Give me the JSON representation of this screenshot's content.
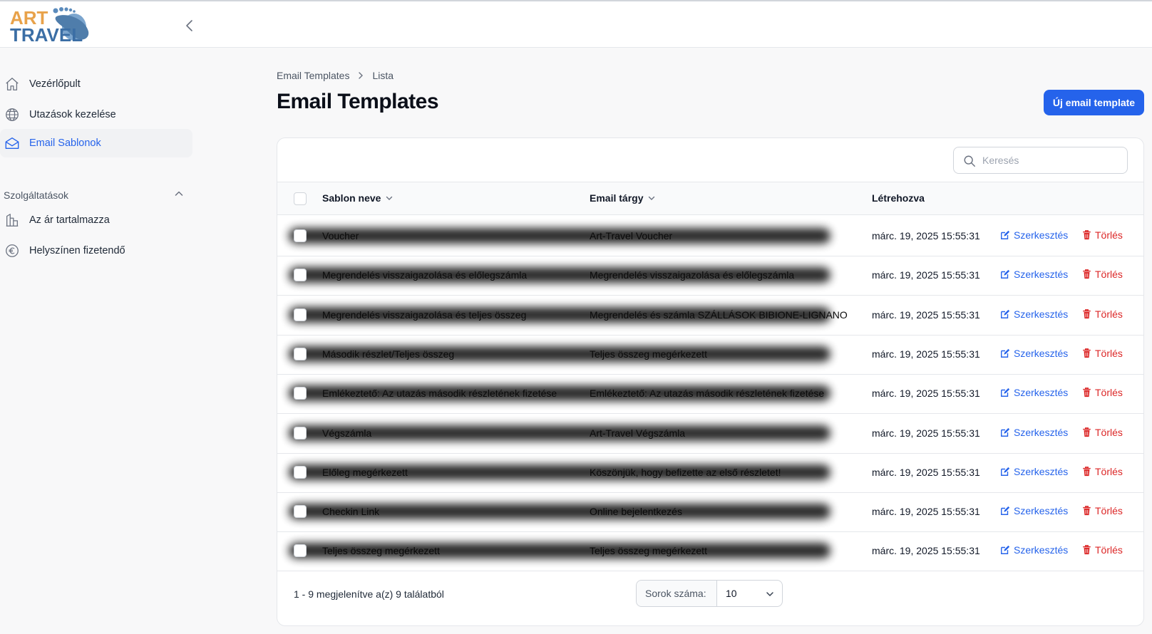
{
  "brand": {
    "logo_top": "ART",
    "logo_bottom": "TRAVEL"
  },
  "sidebar": {
    "items": [
      {
        "label": "Vezérlőpult",
        "icon": "home-icon"
      },
      {
        "label": "Utazások kezelése",
        "icon": "globe-icon"
      },
      {
        "label": "Email Sablonok",
        "icon": "envelope-open-icon",
        "active": true
      }
    ],
    "group": {
      "label": "Szolgáltatások",
      "items": [
        {
          "label": "Az ár tartalmazza",
          "icon": "building-library-icon"
        },
        {
          "label": "Helyszínen fizetendő",
          "icon": "euro-icon"
        }
      ]
    }
  },
  "breadcrumb": {
    "parent": "Email Templates",
    "current": "Lista"
  },
  "page": {
    "title": "Email Templates",
    "new_button": "Új email template"
  },
  "search": {
    "placeholder": "Keresés",
    "value": ""
  },
  "table": {
    "columns": {
      "name": "Sablon neve",
      "subject": "Email tárgy",
      "created": "Létrehozva"
    },
    "actions": {
      "edit": "Szerkesztés",
      "delete": "Törlés"
    },
    "rows": [
      {
        "name": "Voucher",
        "subject": "Art-Travel Voucher",
        "created": "márc. 19, 2025 15:55:31"
      },
      {
        "name": "Megrendelés visszaigazolása és előlegszámla",
        "subject": "Megrendelés visszaigazolása és előlegszámla",
        "created": "márc. 19, 2025 15:55:31"
      },
      {
        "name": "Megrendelés visszaigazolása és teljes összeg",
        "subject": "Megrendelés és számla SZÁLLÁSOK BIBIONE-LIGNANO",
        "created": "márc. 19, 2025 15:55:31"
      },
      {
        "name": "Második részlet/Teljes összeg",
        "subject": "Teljes összeg megérkezett",
        "created": "márc. 19, 2025 15:55:31"
      },
      {
        "name": "Emlékeztető: Az utazás második részletének fizetése",
        "subject": "Emlékeztető: Az utazás második részletének fizetése",
        "created": "márc. 19, 2025 15:55:31"
      },
      {
        "name": "Végszámla",
        "subject": "Art-Travel Végszámla",
        "created": "márc. 19, 2025 15:55:31"
      },
      {
        "name": "Előleg megérkezett",
        "subject": "Köszönjük, hogy befizette az első részletet!",
        "created": "márc. 19, 2025 15:55:31"
      },
      {
        "name": "Checkin Link",
        "subject": "Online bejelentkezés",
        "created": "márc. 19, 2025 15:55:31"
      },
      {
        "name": "Teljes összeg megérkezett",
        "subject": "Teljes összeg megérkezett",
        "created": "márc. 19, 2025 15:55:31"
      }
    ]
  },
  "footer": {
    "summary": "1 - 9 megjelenítve a(z) 9 találatból",
    "per_page_label": "Sorok száma:",
    "per_page_value": "10"
  },
  "colors": {
    "accent": "#2563eb",
    "danger": "#dc2626",
    "logo_orange": "#e8a24a",
    "logo_blue": "#3b6ea5"
  }
}
